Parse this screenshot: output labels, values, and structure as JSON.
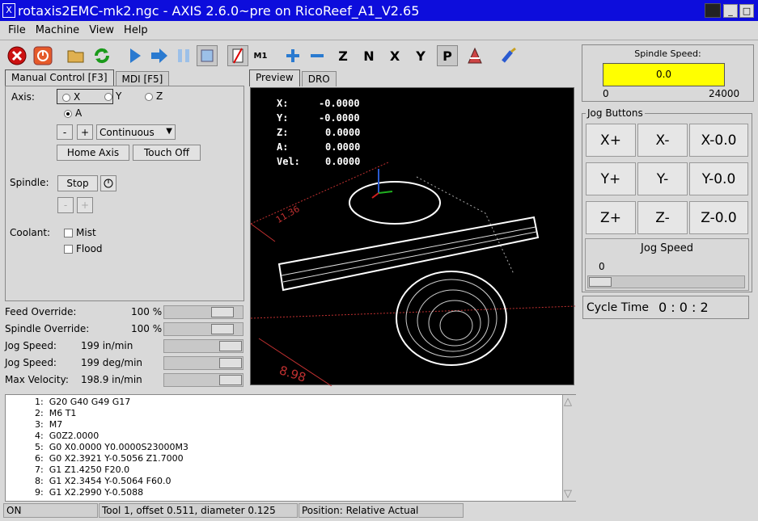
{
  "window": {
    "title": "rotaxis2EMC-mk2.ngc - AXIS 2.6.0~pre on RicoReef_A1_V2.65"
  },
  "menu": [
    "File",
    "Machine",
    "View",
    "Help"
  ],
  "toolbar_icons": [
    "estop-icon",
    "power-icon",
    "open-file-icon",
    "reload-icon",
    "run-icon",
    "step-icon",
    "pause-icon",
    "stop-icon",
    "block-delete-icon",
    "optional-stop-icon",
    "zoom-in-icon",
    "zoom-out-icon",
    "view-z-icon",
    "view-rotated-z-icon",
    "view-x-icon",
    "view-y-icon",
    "view-perspective-icon",
    "toggle-plot-icon",
    "clear-plot-icon"
  ],
  "left_tabs": [
    "Manual Control [F3]",
    "MDI [F5]"
  ],
  "manual": {
    "axis_label": "Axis:",
    "axes": [
      "X",
      "Y",
      "Z",
      "A"
    ],
    "selected_axis": "A",
    "minus": "-",
    "plus": "+",
    "jog_mode": "Continuous",
    "home_axis": "Home Axis",
    "touch_off": "Touch Off",
    "spindle_label": "Spindle:",
    "spindle_stop": "Stop",
    "coolant_label": "Coolant:",
    "mist": "Mist",
    "flood": "Flood"
  },
  "overrides": [
    {
      "label": "Feed Override:",
      "value": "100 %",
      "level": 0.75
    },
    {
      "label": "Spindle Override:",
      "value": "100 %",
      "level": 0.75
    },
    {
      "label": "Jog Speed:",
      "value": "199 in/min",
      "level": 0.9
    },
    {
      "label": "Jog Speed:",
      "value": "199 deg/min",
      "level": 0.9
    },
    {
      "label": "Max Velocity:",
      "value": "198.9 in/min",
      "level": 0.9
    }
  ],
  "view_tabs": [
    "Preview",
    "DRO"
  ],
  "dro": [
    {
      "axis": "X:",
      "value": "-0.0000"
    },
    {
      "axis": "Y:",
      "value": "-0.0000"
    },
    {
      "axis": "Z:",
      "value": "0.0000"
    },
    {
      "axis": "A:",
      "value": "0.0000"
    },
    {
      "axis": "Vel:",
      "value": "0.0000"
    }
  ],
  "preview_labels": {
    "dim_y": "11.36",
    "dim_x": "8.98"
  },
  "gcode": [
    {
      "n": "1:",
      "code": "G20 G40 G49 G17"
    },
    {
      "n": "2:",
      "code": "M6 T1"
    },
    {
      "n": "3:",
      "code": "M7"
    },
    {
      "n": "4:",
      "code": "G0Z2.0000"
    },
    {
      "n": "5:",
      "code": "G0 X0.0000 Y0.0000S23000M3"
    },
    {
      "n": "6:",
      "code": "G0 X2.3921 Y-0.5056 Z1.7000"
    },
    {
      "n": "7:",
      "code": "G1 Z1.4250 F20.0"
    },
    {
      "n": "8:",
      "code": "G1 X2.3454 Y-0.5064 F60.0"
    },
    {
      "n": "9:",
      "code": "G1 X2.2990 Y-0.5088"
    }
  ],
  "status": {
    "state": "ON",
    "tool": "Tool 1, offset 0.511, diameter 0.125",
    "position": "Position: Relative Actual"
  },
  "spindle_speed": {
    "title": "Spindle Speed:",
    "value": "0.0",
    "min": "0",
    "max": "24000",
    "color": "#ffff00"
  },
  "jog_buttons": {
    "title": "Jog Buttons",
    "rows": [
      [
        "X+",
        "X-",
        "X-0.0"
      ],
      [
        "Y+",
        "Y-",
        "Y-0.0"
      ],
      [
        "Z+",
        "Z-",
        "Z-0.0"
      ]
    ],
    "jog_speed_label": "Jog Speed",
    "jog_speed_value": "0",
    "jog_speed_level": 0.0
  },
  "cycle_time": {
    "label": "Cycle Time",
    "value": "0 : 0 : 2"
  }
}
